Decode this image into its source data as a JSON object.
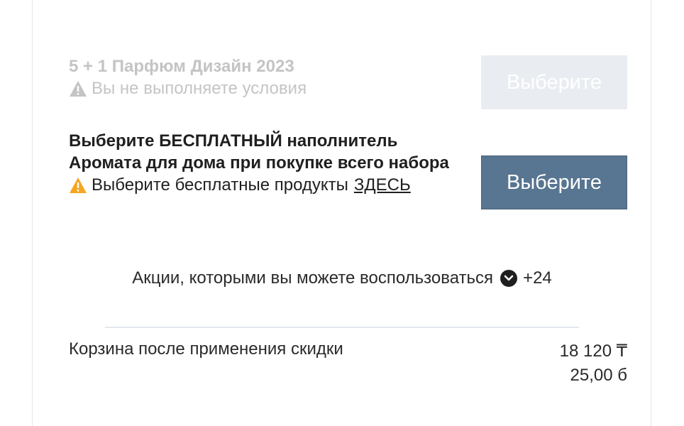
{
  "offers": [
    {
      "title": "5 + 1 Парфюм Дизайн 2023",
      "note": "Вы не выполняете условия",
      "button_label": "Выберите",
      "enabled": false
    },
    {
      "title": "Выберите БЕСПЛАТНЫЙ наполнитель Аромата для дома при покупке всего набора",
      "note": "Выберите бесплатные продукты",
      "link_label": "ЗДЕСЬ",
      "button_label": "Выберите",
      "enabled": true
    }
  ],
  "promotions": {
    "label": "Акции, которыми вы можете воспользоваться",
    "count": "+24"
  },
  "cart": {
    "label": "Корзина после применения скидки",
    "total": "18 120 ₸",
    "points": "25,00 б"
  },
  "colors": {
    "accent_button": "#587591",
    "disabled_button": "#e9edf1",
    "warning_active": "#f5a623",
    "warning_disabled": "#c4c4c4"
  },
  "icons": {
    "warning": "warning-triangle-icon",
    "expand": "chevron-down-circle-icon"
  }
}
